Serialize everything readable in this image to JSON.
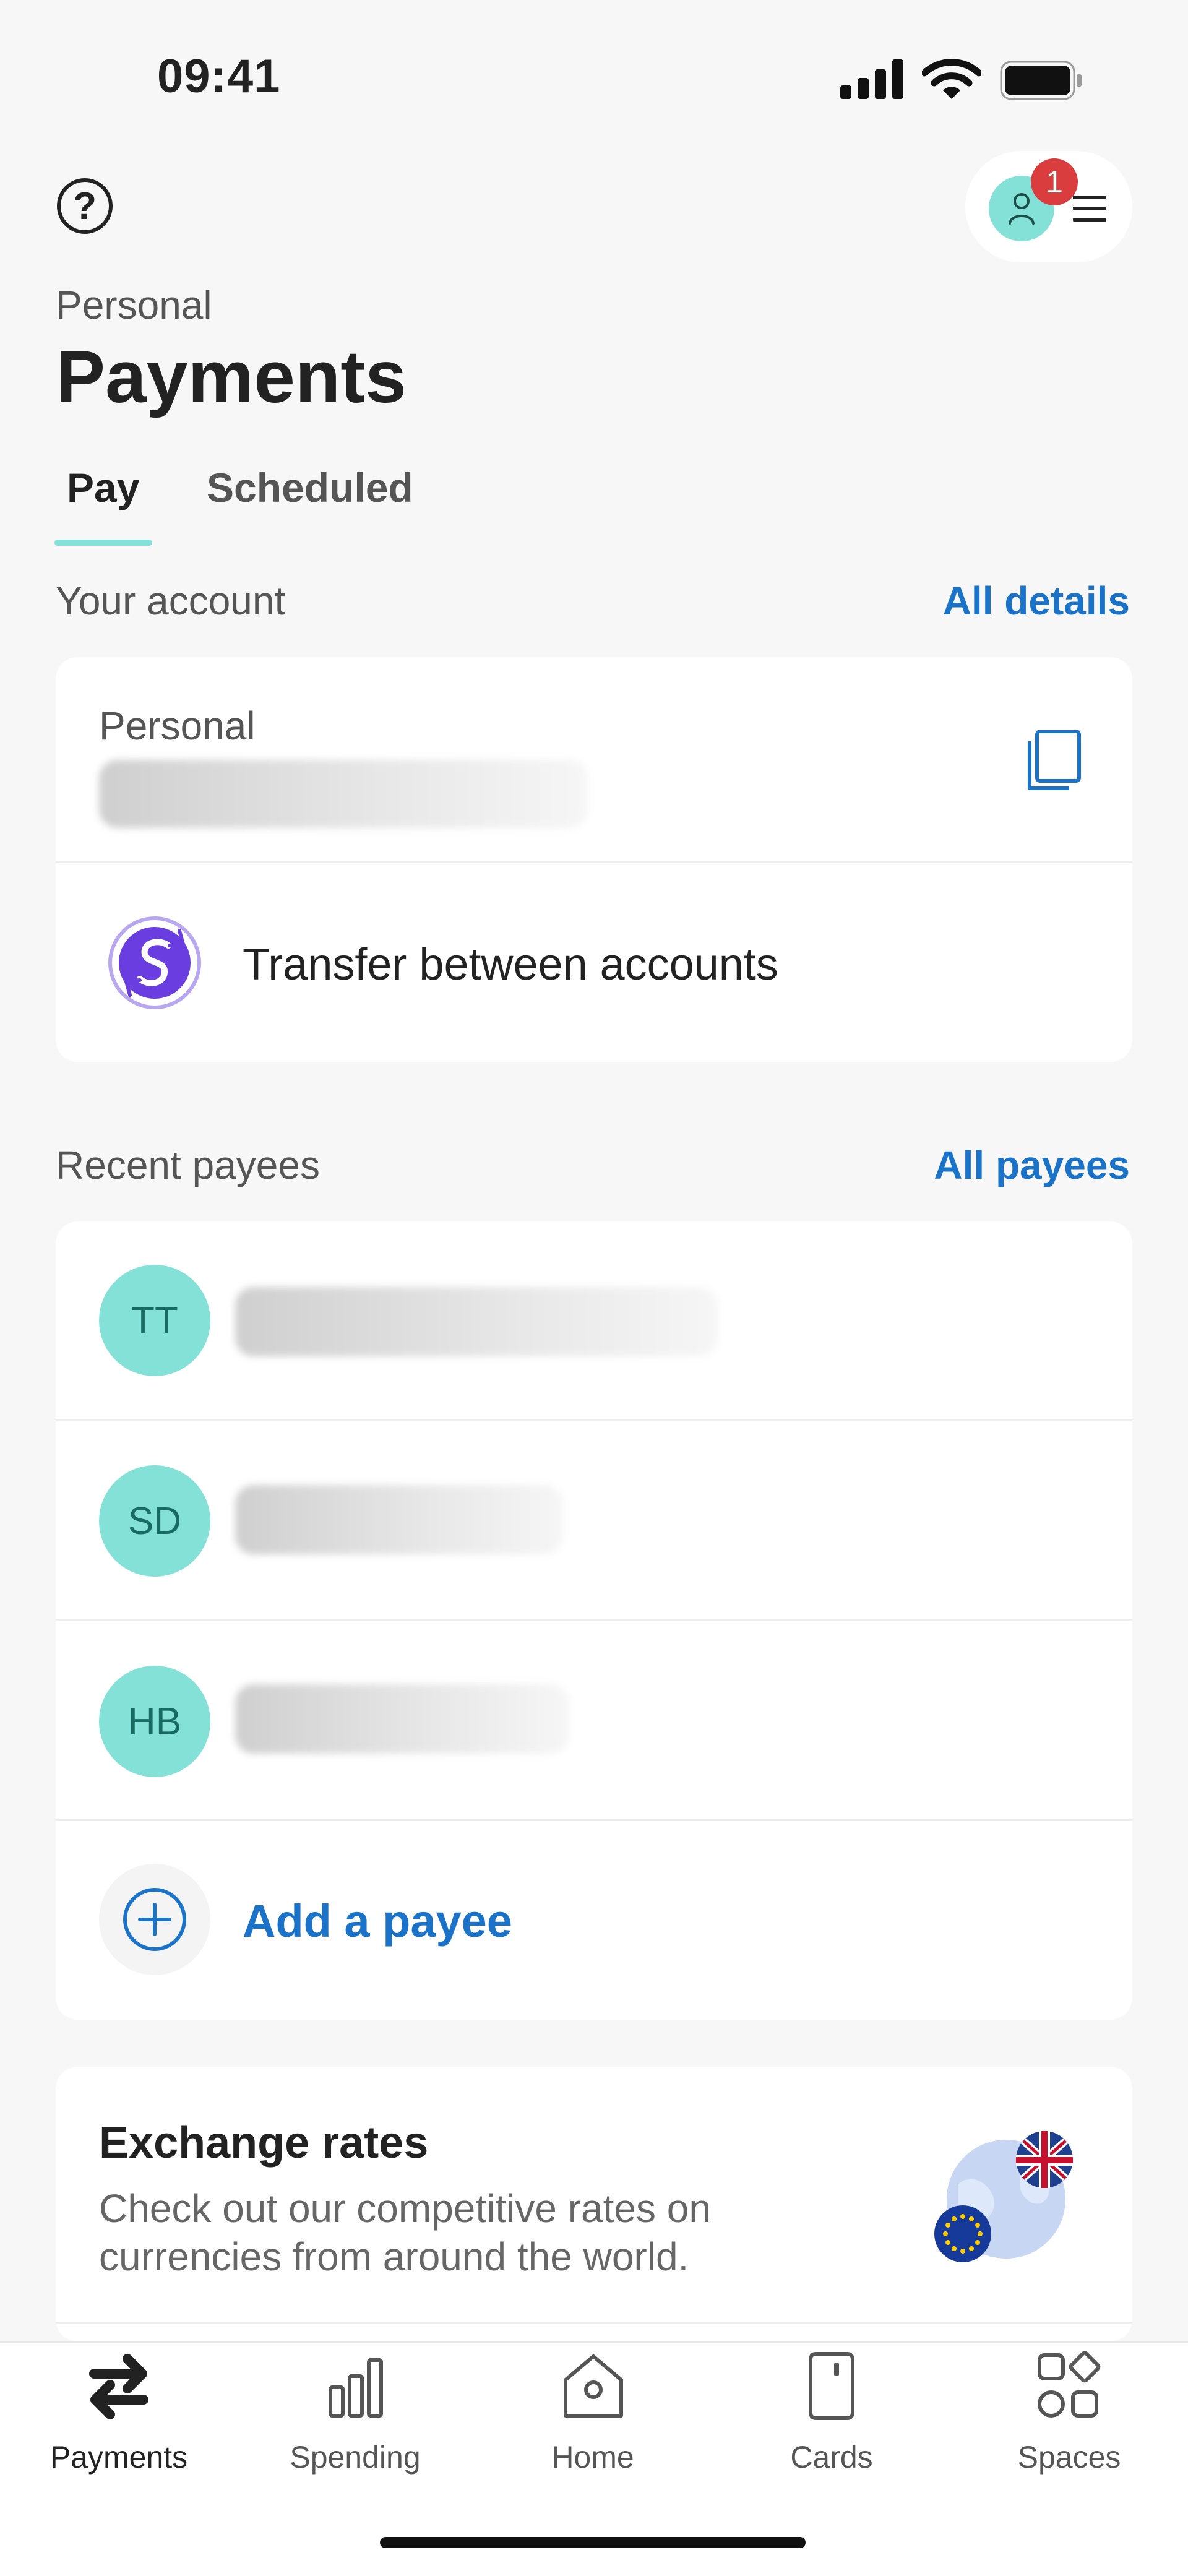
{
  "status_bar": {
    "time": "09:41"
  },
  "header": {
    "notification_count": "1",
    "subtitle": "Personal",
    "title": "Payments"
  },
  "tabs": [
    {
      "label": "Pay",
      "active": true
    },
    {
      "label": "Scheduled",
      "active": false
    }
  ],
  "your_account": {
    "label": "Your account",
    "link": "All details",
    "account_name": "Personal",
    "transfer_label": "Transfer between accounts"
  },
  "recent_payees": {
    "label": "Recent payees",
    "link": "All payees",
    "payees": [
      {
        "initials": "TT"
      },
      {
        "initials": "SD"
      },
      {
        "initials": "HB"
      }
    ],
    "add_label": "Add a payee"
  },
  "exchange_rates": {
    "title": "Exchange rates",
    "description": "Check out our competitive rates on currencies from around the world."
  },
  "bottom_nav": [
    {
      "label": "Payments",
      "icon": "payments-arrows-icon",
      "active": true
    },
    {
      "label": "Spending",
      "icon": "bar-chart-icon",
      "active": false
    },
    {
      "label": "Home",
      "icon": "home-icon",
      "active": false
    },
    {
      "label": "Cards",
      "icon": "card-icon",
      "active": false
    },
    {
      "label": "Spaces",
      "icon": "spaces-grid-icon",
      "active": false
    }
  ],
  "colors": {
    "accent": "#84e1d7",
    "link": "#1a73c9",
    "badge": "#d93d3d",
    "background": "#f7f7f7"
  }
}
